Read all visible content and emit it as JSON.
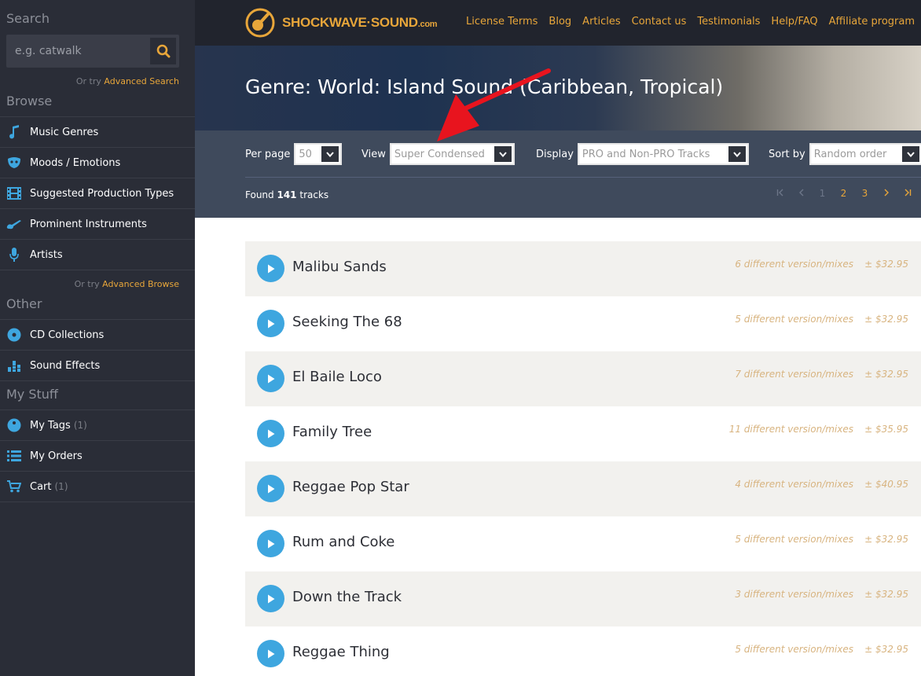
{
  "sidebar": {
    "search_title": "Search",
    "search_placeholder": "e.g. catwalk",
    "search_or_try_prefix": "Or try",
    "search_or_try_link": "Advanced Search",
    "browse_title": "Browse",
    "browse_items": [
      {
        "label": "Music Genres",
        "icon": "music-note-icon"
      },
      {
        "label": "Moods / Emotions",
        "icon": "mask-icon"
      },
      {
        "label": "Suggested Production Types",
        "icon": "film-icon"
      },
      {
        "label": "Prominent Instruments",
        "icon": "guitar-icon"
      },
      {
        "label": "Artists",
        "icon": "microphone-icon"
      }
    ],
    "browse_or_try_prefix": "Or try",
    "browse_or_try_link": "Advanced Browse",
    "other_title": "Other",
    "other_items": [
      {
        "label": "CD Collections",
        "icon": "cd-icon"
      },
      {
        "label": "Sound Effects",
        "icon": "equalizer-icon"
      }
    ],
    "mystuff_title": "My Stuff",
    "mystuff_items": [
      {
        "label": "My Tags",
        "count": "(1)",
        "icon": "tag-icon"
      },
      {
        "label": "My Orders",
        "count": "",
        "icon": "list-icon"
      },
      {
        "label": "Cart",
        "count": "(1)",
        "icon": "cart-icon"
      }
    ]
  },
  "header": {
    "logo_text": "SHOCKWAVE·SOUND",
    "logo_suffix": ".com",
    "nav": [
      "License Terms",
      "Blog",
      "Articles",
      "Contact us",
      "Testimonials",
      "Help/FAQ",
      "Affiliate program"
    ]
  },
  "hero": {
    "title": "Genre: World: Island Sound (Caribbean, Tropical)"
  },
  "filters": {
    "per_page_label": "Per page",
    "per_page_value": "50",
    "view_label": "View",
    "view_value": "Super Condensed",
    "display_label": "Display",
    "display_value": "PRO and Non-PRO Tracks",
    "sort_label": "Sort by",
    "sort_value": "Random order"
  },
  "results": {
    "found_prefix": "Found",
    "found_count": "141",
    "found_suffix": "tracks",
    "pages": [
      "1",
      "2",
      "3"
    ]
  },
  "colors": {
    "accent": "#e8a63a",
    "play": "#3ea6df",
    "sidebar_bg": "#2a2d37",
    "filter_bg": "#3f4a5c",
    "annotation": "#e8141e"
  },
  "tracks": [
    {
      "title": "Malibu Sands",
      "versions": "6 different version/mixes",
      "price": "± $32.95"
    },
    {
      "title": "Seeking The 68",
      "versions": "5 different version/mixes",
      "price": "± $32.95"
    },
    {
      "title": "El Baile Loco",
      "versions": "7 different version/mixes",
      "price": "± $32.95"
    },
    {
      "title": "Family Tree",
      "versions": "11 different version/mixes",
      "price": "± $35.95"
    },
    {
      "title": "Reggae Pop Star",
      "versions": "4 different version/mixes",
      "price": "± $40.95"
    },
    {
      "title": "Rum and Coke",
      "versions": "5 different version/mixes",
      "price": "± $32.95"
    },
    {
      "title": "Down the Track",
      "versions": "3 different version/mixes",
      "price": "± $32.95"
    },
    {
      "title": "Reggae Thing",
      "versions": "5 different version/mixes",
      "price": "± $32.95"
    }
  ]
}
